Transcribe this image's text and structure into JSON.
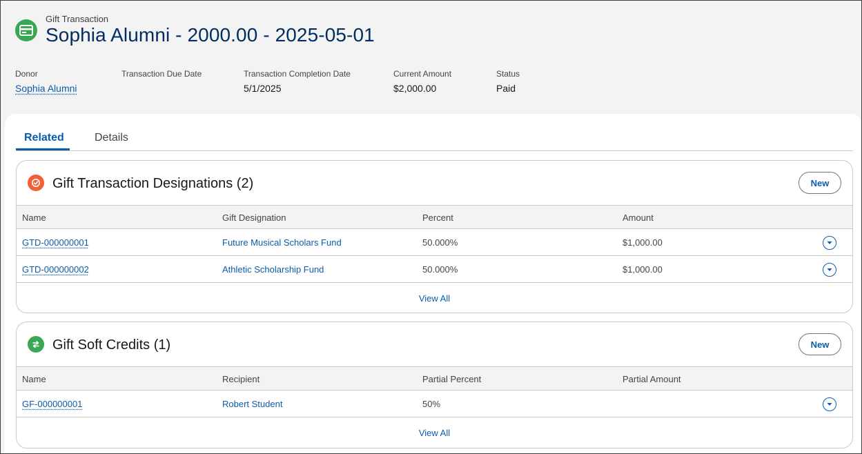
{
  "header": {
    "record_type": "Gift Transaction",
    "title": "Sophia Alumni - 2000.00 - 2025-05-01",
    "icon": "gift-transaction-icon",
    "icon_color": "#3ba755",
    "fields": [
      {
        "label": "Donor",
        "value": "Sophia Alumni"
      },
      {
        "label": "Transaction Due Date",
        "value": ""
      },
      {
        "label": "Transaction Completion Date",
        "value": "5/1/2025"
      },
      {
        "label": "Current Amount",
        "value": "$2,000.00"
      },
      {
        "label": "Status",
        "value": "Paid"
      }
    ]
  },
  "tabs": [
    {
      "label": "Related",
      "active": true
    },
    {
      "label": "Details",
      "active": false
    }
  ],
  "designations": {
    "title": "Gift Transaction Designations (2)",
    "icon_color": "#f06135",
    "new_label": "New",
    "columns": [
      "Name",
      "Gift Designation",
      "Percent",
      "Amount"
    ],
    "rows": [
      {
        "name": "GTD-000000001",
        "designation": "Future Musical Scholars Fund",
        "percent": "50.000%",
        "amount": "$1,000.00"
      },
      {
        "name": "GTD-000000002",
        "designation": "Athletic Scholarship Fund",
        "percent": "50.000%",
        "amount": "$1,000.00"
      }
    ],
    "view_all": "View All"
  },
  "soft_credits": {
    "title": "Gift Soft Credits (1)",
    "icon_color": "#3ba755",
    "new_label": "New",
    "columns": [
      "Name",
      "Recipient",
      "Partial Percent",
      "Partial Amount"
    ],
    "rows": [
      {
        "name": "GF-000000001",
        "recipient": "Robert Student",
        "percent": "50%",
        "amount": ""
      }
    ],
    "view_all": "View All"
  },
  "colors": {
    "brand_link": "#0b5cab",
    "title_navy": "#032d60"
  }
}
